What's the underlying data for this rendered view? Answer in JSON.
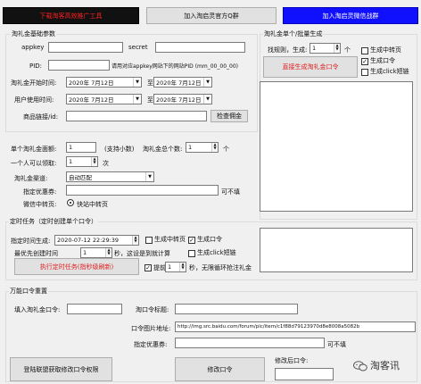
{
  "top_buttons": {
    "left": "下载淘客高效推广工具",
    "middle": "加入淘启灵官方Q群",
    "right": "加入淘启灵微信战群"
  },
  "colors": {
    "top_left_bg": "#111111",
    "top_left_fg": "#ff2020",
    "top_right_bg": "#1010ff",
    "red_text": "#e02020",
    "accent_blue": "#1e6ed6"
  },
  "basic": {
    "title": "淘礼金基础参数",
    "appkey_label": "appkey",
    "secret_label": "secret",
    "pid_label": "PID:",
    "pid_hint": "请用对应appkey网站下的网站PID (mm_00_00_00)",
    "start_label": "淘礼金开始时间:",
    "start_date": "2020年 7月12日",
    "to1": "至",
    "start_end_date": "2020年 7月12日",
    "use_label": "用户使用时间:",
    "use_date": "2020年 7月12日",
    "to2": "至",
    "use_end_date": "2020年 7月12日",
    "goods_label": "商品链接/id:",
    "check_btn": "检查佣金"
  },
  "amount": {
    "single_label": "单个淘礼金面额:",
    "single_value": "1",
    "single_hint": "(支持小数)",
    "total_label": "淘礼金总个数:",
    "total_value": "1",
    "total_unit": "个",
    "per_user_label": "一个人可以领取:",
    "per_user_value": "1",
    "per_user_unit": "次",
    "channel_label": "淘礼金渠道:",
    "channel_value": "自动匹配",
    "coupon_label": "指定优惠券:",
    "coupon_hint": "可不填",
    "wechat_label": "微信中转页:",
    "wechat_option": "快站中转页"
  },
  "single_batch": {
    "title": "淘礼金单个/批量生成",
    "batch_label": "找规则，生成:",
    "batch_value": "1",
    "batch_unit": "个",
    "gen_btn": "直接生成淘礼金口令",
    "opt_redirect": "生成中转页",
    "opt_code": "生成口令",
    "opt_click": "生成click短链",
    "opt_code_checked": true
  },
  "timer": {
    "title": "定时任务（定时创建单个口令）",
    "time_label": "指定时间生成:",
    "time_value": "2020-07-12 22:29:39",
    "opt_redirect": "生成中转页",
    "opt_code": "生成口令",
    "opt_click": "生成click短链",
    "interval_label": "最优先创建时间",
    "interval_value": "1",
    "interval_hint": "秒，这设是到就计算",
    "run_btn": "执行定时任务(指秒级刷新)",
    "advance_label": "提前",
    "advance_value": "1",
    "advance_hint": "秒，无限循环抢注礼金"
  },
  "universal": {
    "title": "万能口令重置",
    "tlj_label": "填入淘礼金口令:",
    "tlj_value": "",
    "title_label": "淘口令标题:",
    "img_label": "口令图片地址:",
    "img_value": "http://img.src.baidu.com/forum/pic/item/c1f88d79123970d8e8008a5082b",
    "coupon_label": "指定优惠券:",
    "coupon_hint": "可不填",
    "login_btn": "登陆联盟获取修改口令权限",
    "modify_btn": "修改口令",
    "result_label": "修改后口令:",
    "watermark": "淘客讯"
  }
}
